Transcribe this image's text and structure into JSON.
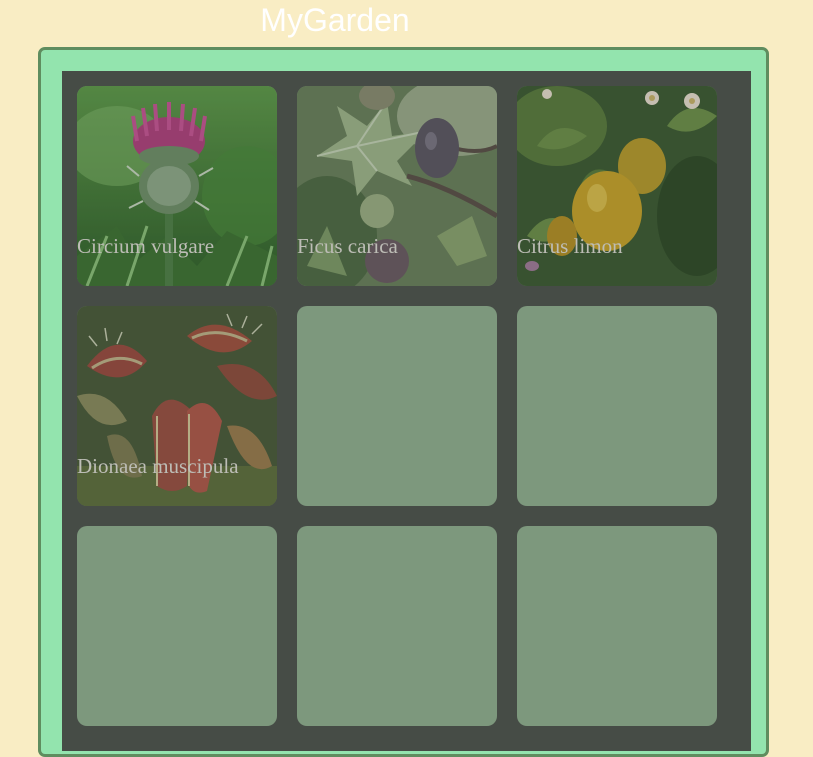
{
  "app": {
    "title": "MyGarden"
  },
  "colors": {
    "page_background": "#f9edc4",
    "frame_fill": "#93e4ae",
    "frame_border": "#5f8d5f",
    "board_background": "#464c46",
    "empty_slot": "#7d987d",
    "plant_label": "#bdbdb6"
  },
  "garden": {
    "columns": 3,
    "rows": 3,
    "slots": [
      {
        "name": "Circium vulgare",
        "image": "thistle-photo"
      },
      {
        "name": "Ficus carica",
        "image": "fig-photo"
      },
      {
        "name": "Citrus limon",
        "image": "lemon-photo"
      },
      {
        "name": "Dionaea muscipula",
        "image": "venus-flytrap-photo"
      },
      {
        "name": "",
        "image": "empty"
      },
      {
        "name": "",
        "image": "empty"
      },
      {
        "name": "",
        "image": "empty"
      },
      {
        "name": "",
        "image": "empty"
      },
      {
        "name": "",
        "image": "empty"
      }
    ]
  }
}
